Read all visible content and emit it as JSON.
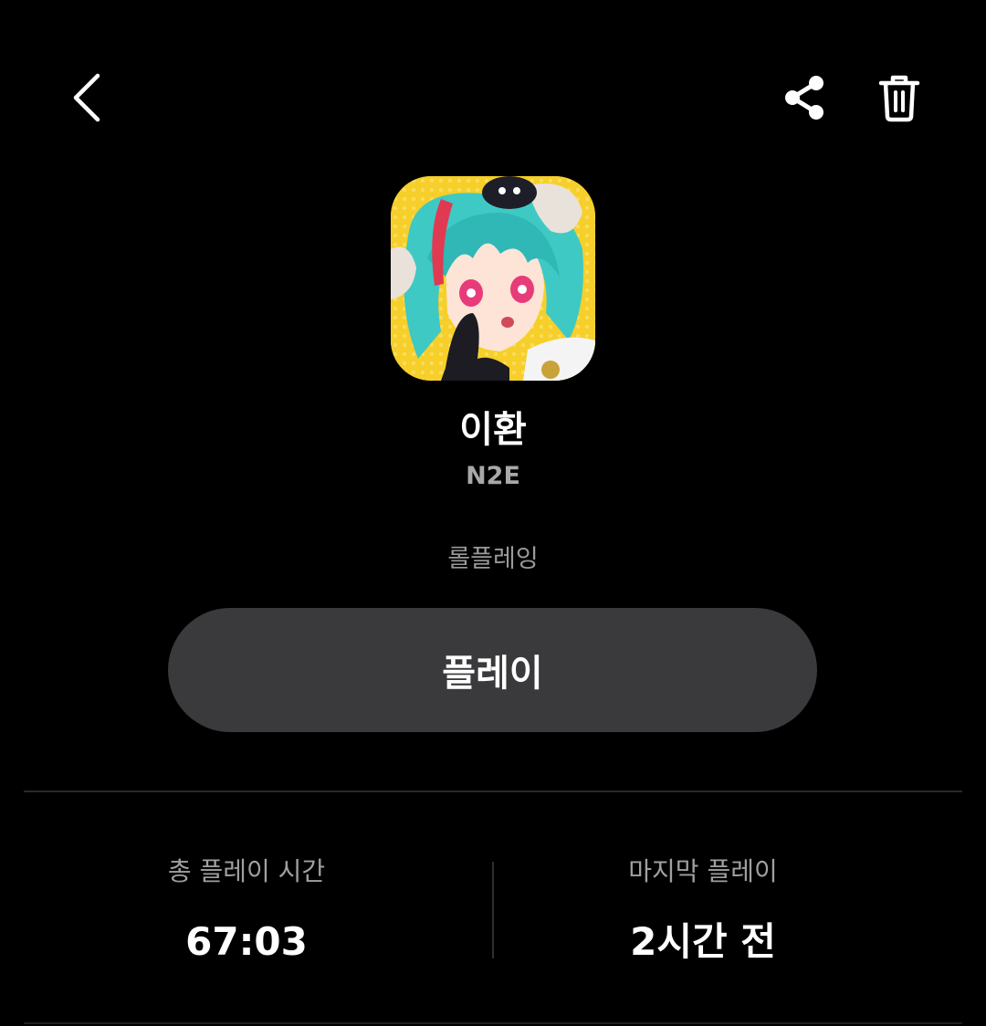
{
  "header": {
    "back_icon": "chevron-left-icon",
    "share_icon": "share-icon",
    "delete_icon": "trash-icon"
  },
  "app": {
    "icon": "character-portrait-icon",
    "title": "이환",
    "developer": "N2E",
    "genre": "롤플레잉",
    "play_label": "플레이"
  },
  "stats": {
    "total_play_time_label": "총 플레이 시간",
    "total_play_time_value": "67:03",
    "last_played_label": "마지막 플레이",
    "last_played_value": "2시간 전"
  },
  "colors": {
    "background": "#000000",
    "button_bg": "#3a3a3c",
    "secondary_text": "#a8a8a8",
    "icon_accent_yellow": "#f6cf2a",
    "hair_teal": "#3ec9c4"
  }
}
